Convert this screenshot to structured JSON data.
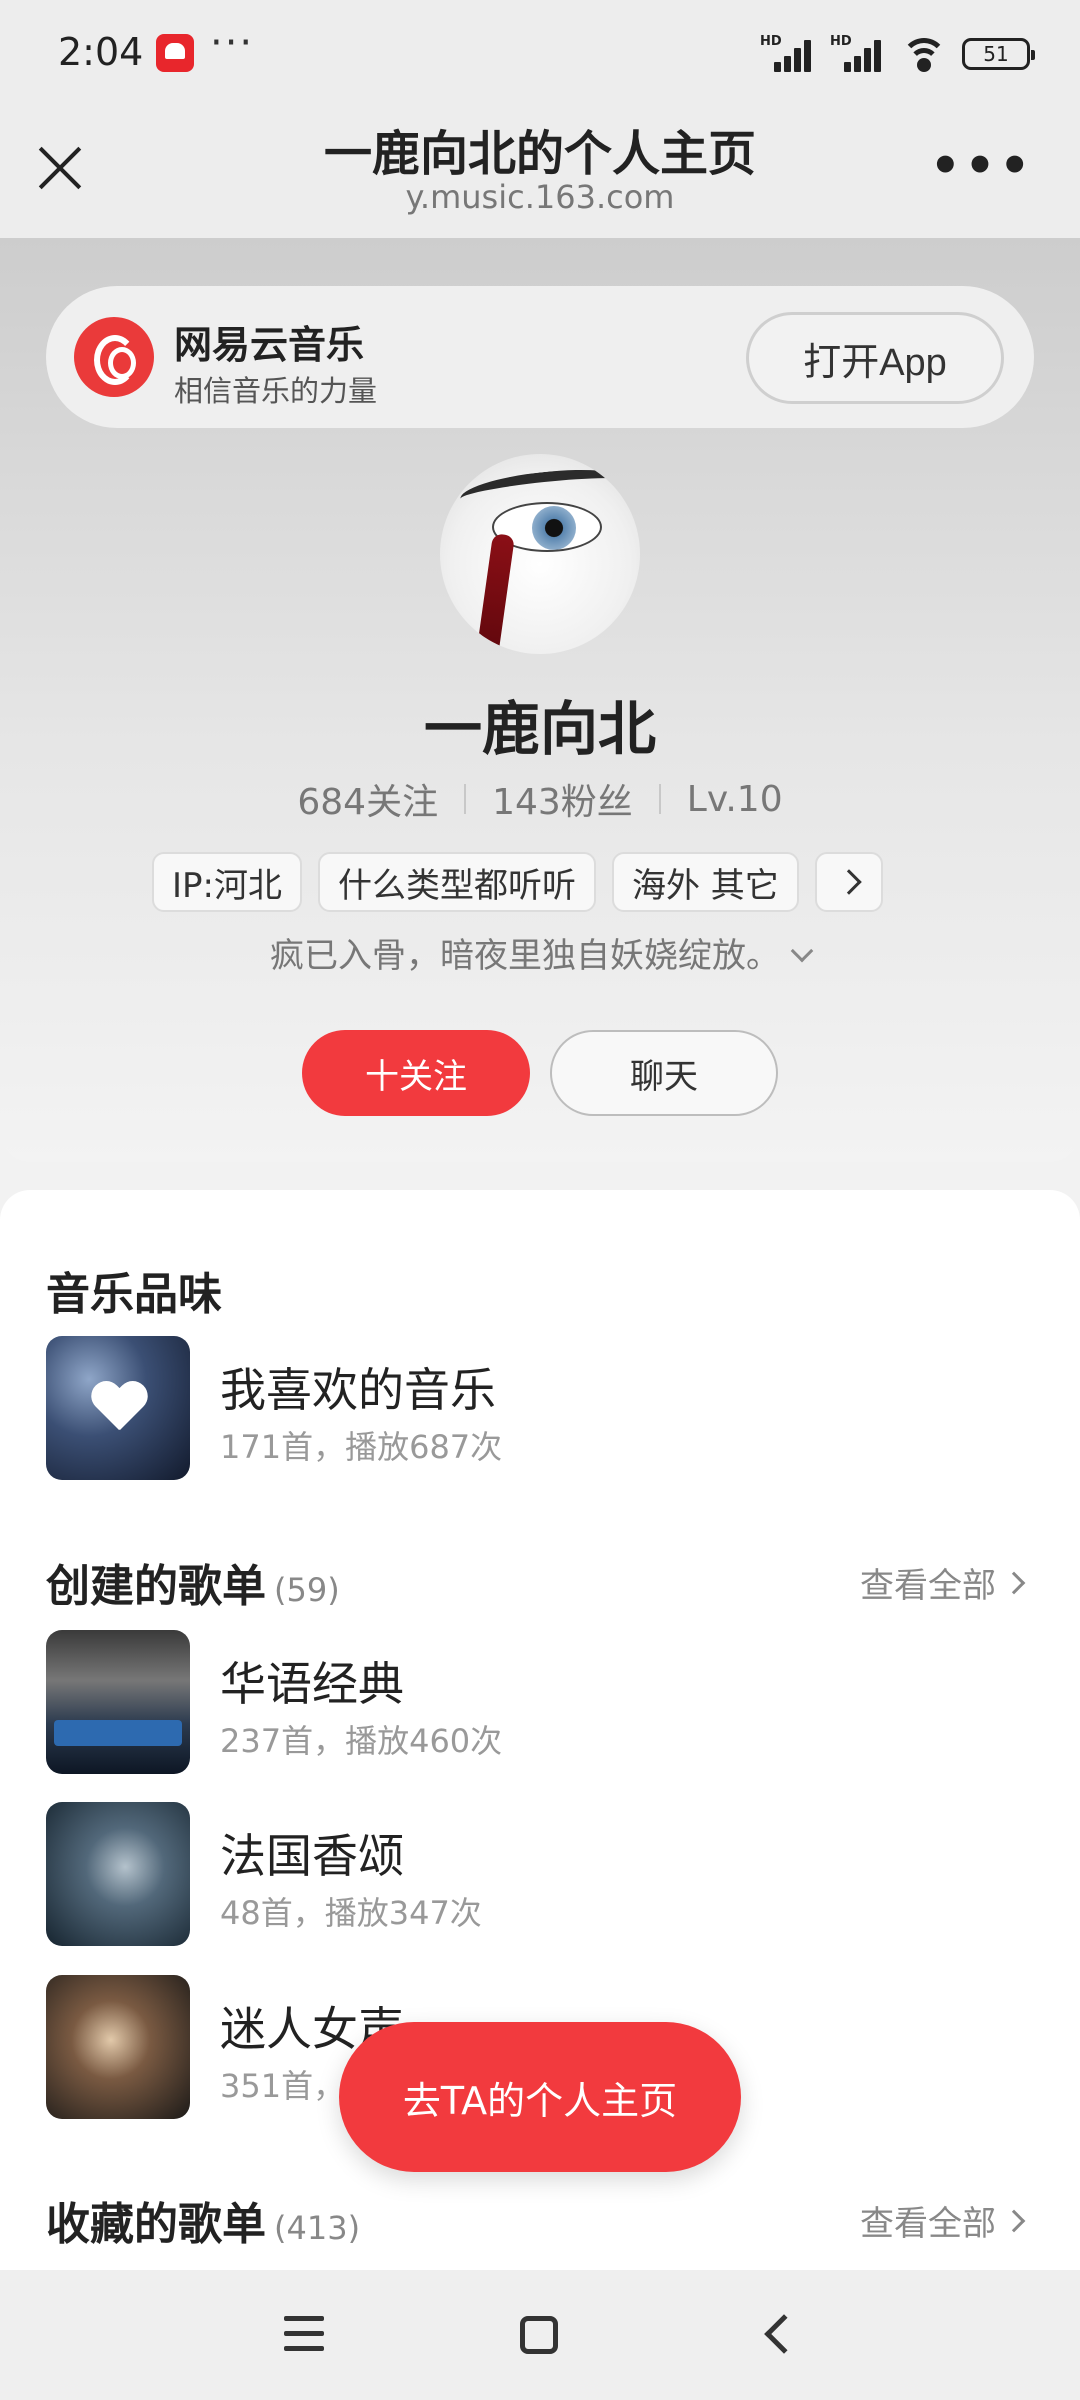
{
  "status_bar": {
    "time": "2:04",
    "dots": "···",
    "hd1": "HD",
    "hd2": "HD",
    "battery": "51"
  },
  "browser": {
    "title": "一鹿向北的个人主页",
    "url": "y.music.163.com"
  },
  "banner": {
    "app_name": "网易云音乐",
    "slogan": "相信音乐的力量",
    "open_app": "打开App"
  },
  "profile": {
    "name": "一鹿向北",
    "following": "684关注",
    "fans": "143粉丝",
    "level": "Lv.10",
    "tags": [
      "IP:河北",
      "什么类型都听听",
      "海外 其它"
    ],
    "bio": "疯已入骨，暗夜里独自妖娆绽放。",
    "follow_label": "十关注",
    "chat_label": "聊天"
  },
  "music_taste": {
    "title": "音乐品味",
    "item": {
      "name": "我喜欢的音乐",
      "sub": "171首，播放687次"
    }
  },
  "created": {
    "title": "创建的歌单",
    "count": "(59)",
    "view_all": "查看全部",
    "items": [
      {
        "name": "华语经典",
        "sub": "237首，播放460次"
      },
      {
        "name": "法国香颂",
        "sub": "48首，播放347次"
      },
      {
        "name": "迷人女声",
        "sub": "351首，播"
      }
    ]
  },
  "collected": {
    "title": "收藏的歌单",
    "count": "(413)",
    "view_all": "查看全部"
  },
  "fab": {
    "label": "去TA的个人主页"
  },
  "colors": {
    "accent": "#f23a3e"
  }
}
